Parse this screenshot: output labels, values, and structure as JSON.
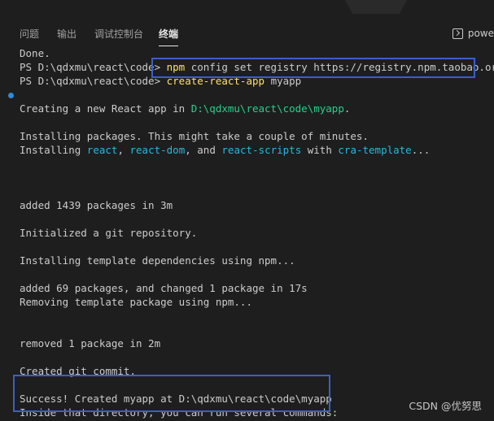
{
  "panel": {
    "tabs": [
      {
        "label": "问题"
      },
      {
        "label": "输出"
      },
      {
        "label": "调试控制台"
      },
      {
        "label": "终端"
      }
    ],
    "active_tab": "终端",
    "shell_label": "powe"
  },
  "terminal": {
    "line_done": "Done.",
    "prompt_1": "PS D:\\qdxmu\\react\\code> ",
    "cmd_1_a": "npm",
    "cmd_1_b": " config set registry https://registry.npm.taobao.org",
    "prompt_2": "PS D:\\qdxmu\\react\\code> ",
    "cmd_2_a": "create-react-app",
    "cmd_2_b": " myapp",
    "creating_pre": "Creating a new React app in ",
    "creating_path": "D:\\qdxmu\\react\\code\\myapp",
    "creating_post": ".",
    "installing_1": "Installing packages. This might take a couple of minutes.",
    "installing_2_pre": "Installing ",
    "pkg_react": "react",
    "sep_1": ", ",
    "pkg_react_dom": "react-dom",
    "sep_2": ", and ",
    "pkg_react_scripts": "react-scripts",
    "sep_3": " with ",
    "pkg_template": "cra-template",
    "ellipsis": "...",
    "added_1": "added 1439 packages in 3m",
    "init_git": "Initialized a git repository.",
    "install_tpl": "Installing template dependencies using npm...",
    "added_2": "added 69 packages, and changed 1 package in 17s",
    "removing_tpl": "Removing template package using npm...",
    "removed": "removed 1 package in 2m",
    "created_commit": "Created git commit.",
    "success": "Success! Created myapp at D:\\qdxmu\\react\\code\\myapp",
    "inside_dir": "Inside that directory, you can run several commands:"
  },
  "watermark": "CSDN @优努思",
  "colors": {
    "background": "#1e1e1e",
    "command": "#ffe066",
    "path": "#23d18b",
    "package": "#29b8db",
    "highlight_box": "#3d5ec9"
  }
}
